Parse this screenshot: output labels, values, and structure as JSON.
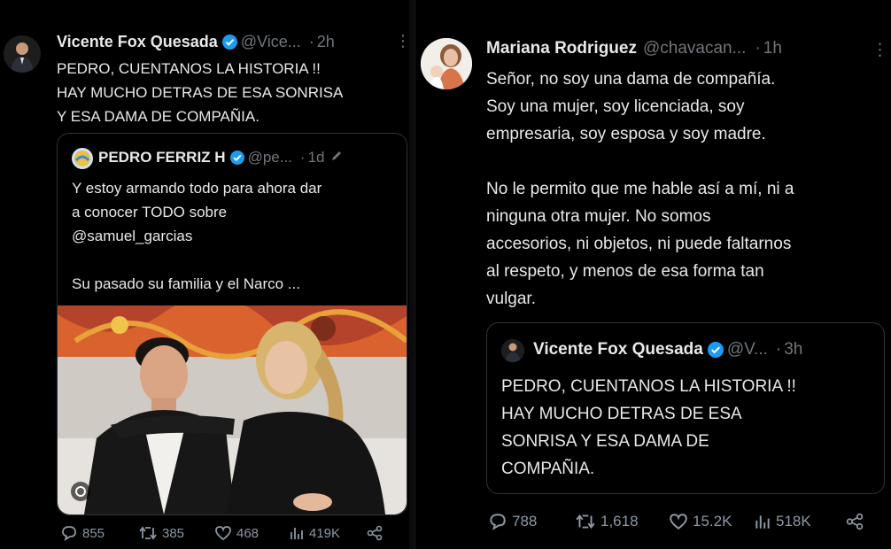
{
  "left_tweet": {
    "name": "Vicente Fox Quesada",
    "handle": "@Vice...",
    "separator": "·",
    "time": "2h",
    "text": "PEDRO, CUENTANOS LA HISTORIA !!\nHAY MUCHO DETRAS DE ESA SONRISA\nY ESA DAMA DE COMPAÑIA.",
    "quote": {
      "name": "PEDRO FERRIZ H",
      "handle": "@pe...",
      "separator": "·",
      "time": "1d",
      "text": "Y estoy armando todo para ahora dar\na conocer TODO sobre\n@samuel_garcias\n\nSu pasado su familia y  el Narco ..."
    },
    "stats": {
      "replies": "855",
      "reposts": "385",
      "likes": "468",
      "views": "419K"
    }
  },
  "right_tweet": {
    "name": "Mariana Rodriguez",
    "handle": "@chavacan...",
    "separator": "·",
    "time": "1h",
    "text": "Señor, no soy una dama de compañía.\nSoy una mujer, soy licenciada, soy\nempresaria, soy esposa y soy madre.\n\nNo le permito que me hable así a mí, ni a\nninguna otra mujer. No somos\naccesorios, ni objetos, ni puede faltarnos\nal respeto, y menos de esa forma tan\nvulgar.",
    "quote": {
      "name": "Vicente Fox Quesada",
      "handle": "@V...",
      "separator": "·",
      "time": "3h",
      "text": "PEDRO, CUENTANOS LA HISTORIA !!\nHAY MUCHO DETRAS DE ESA\nSONRISA Y ESA DAMA DE\nCOMPAÑIA."
    },
    "stats": {
      "replies": "788",
      "reposts": "1,618",
      "likes": "15.2K",
      "views": "518K"
    }
  },
  "colors": {
    "background": "#000000",
    "text": "#e7e9ea",
    "muted": "#71767b",
    "verified": "#1d9bf0",
    "border": "#2f3336"
  }
}
